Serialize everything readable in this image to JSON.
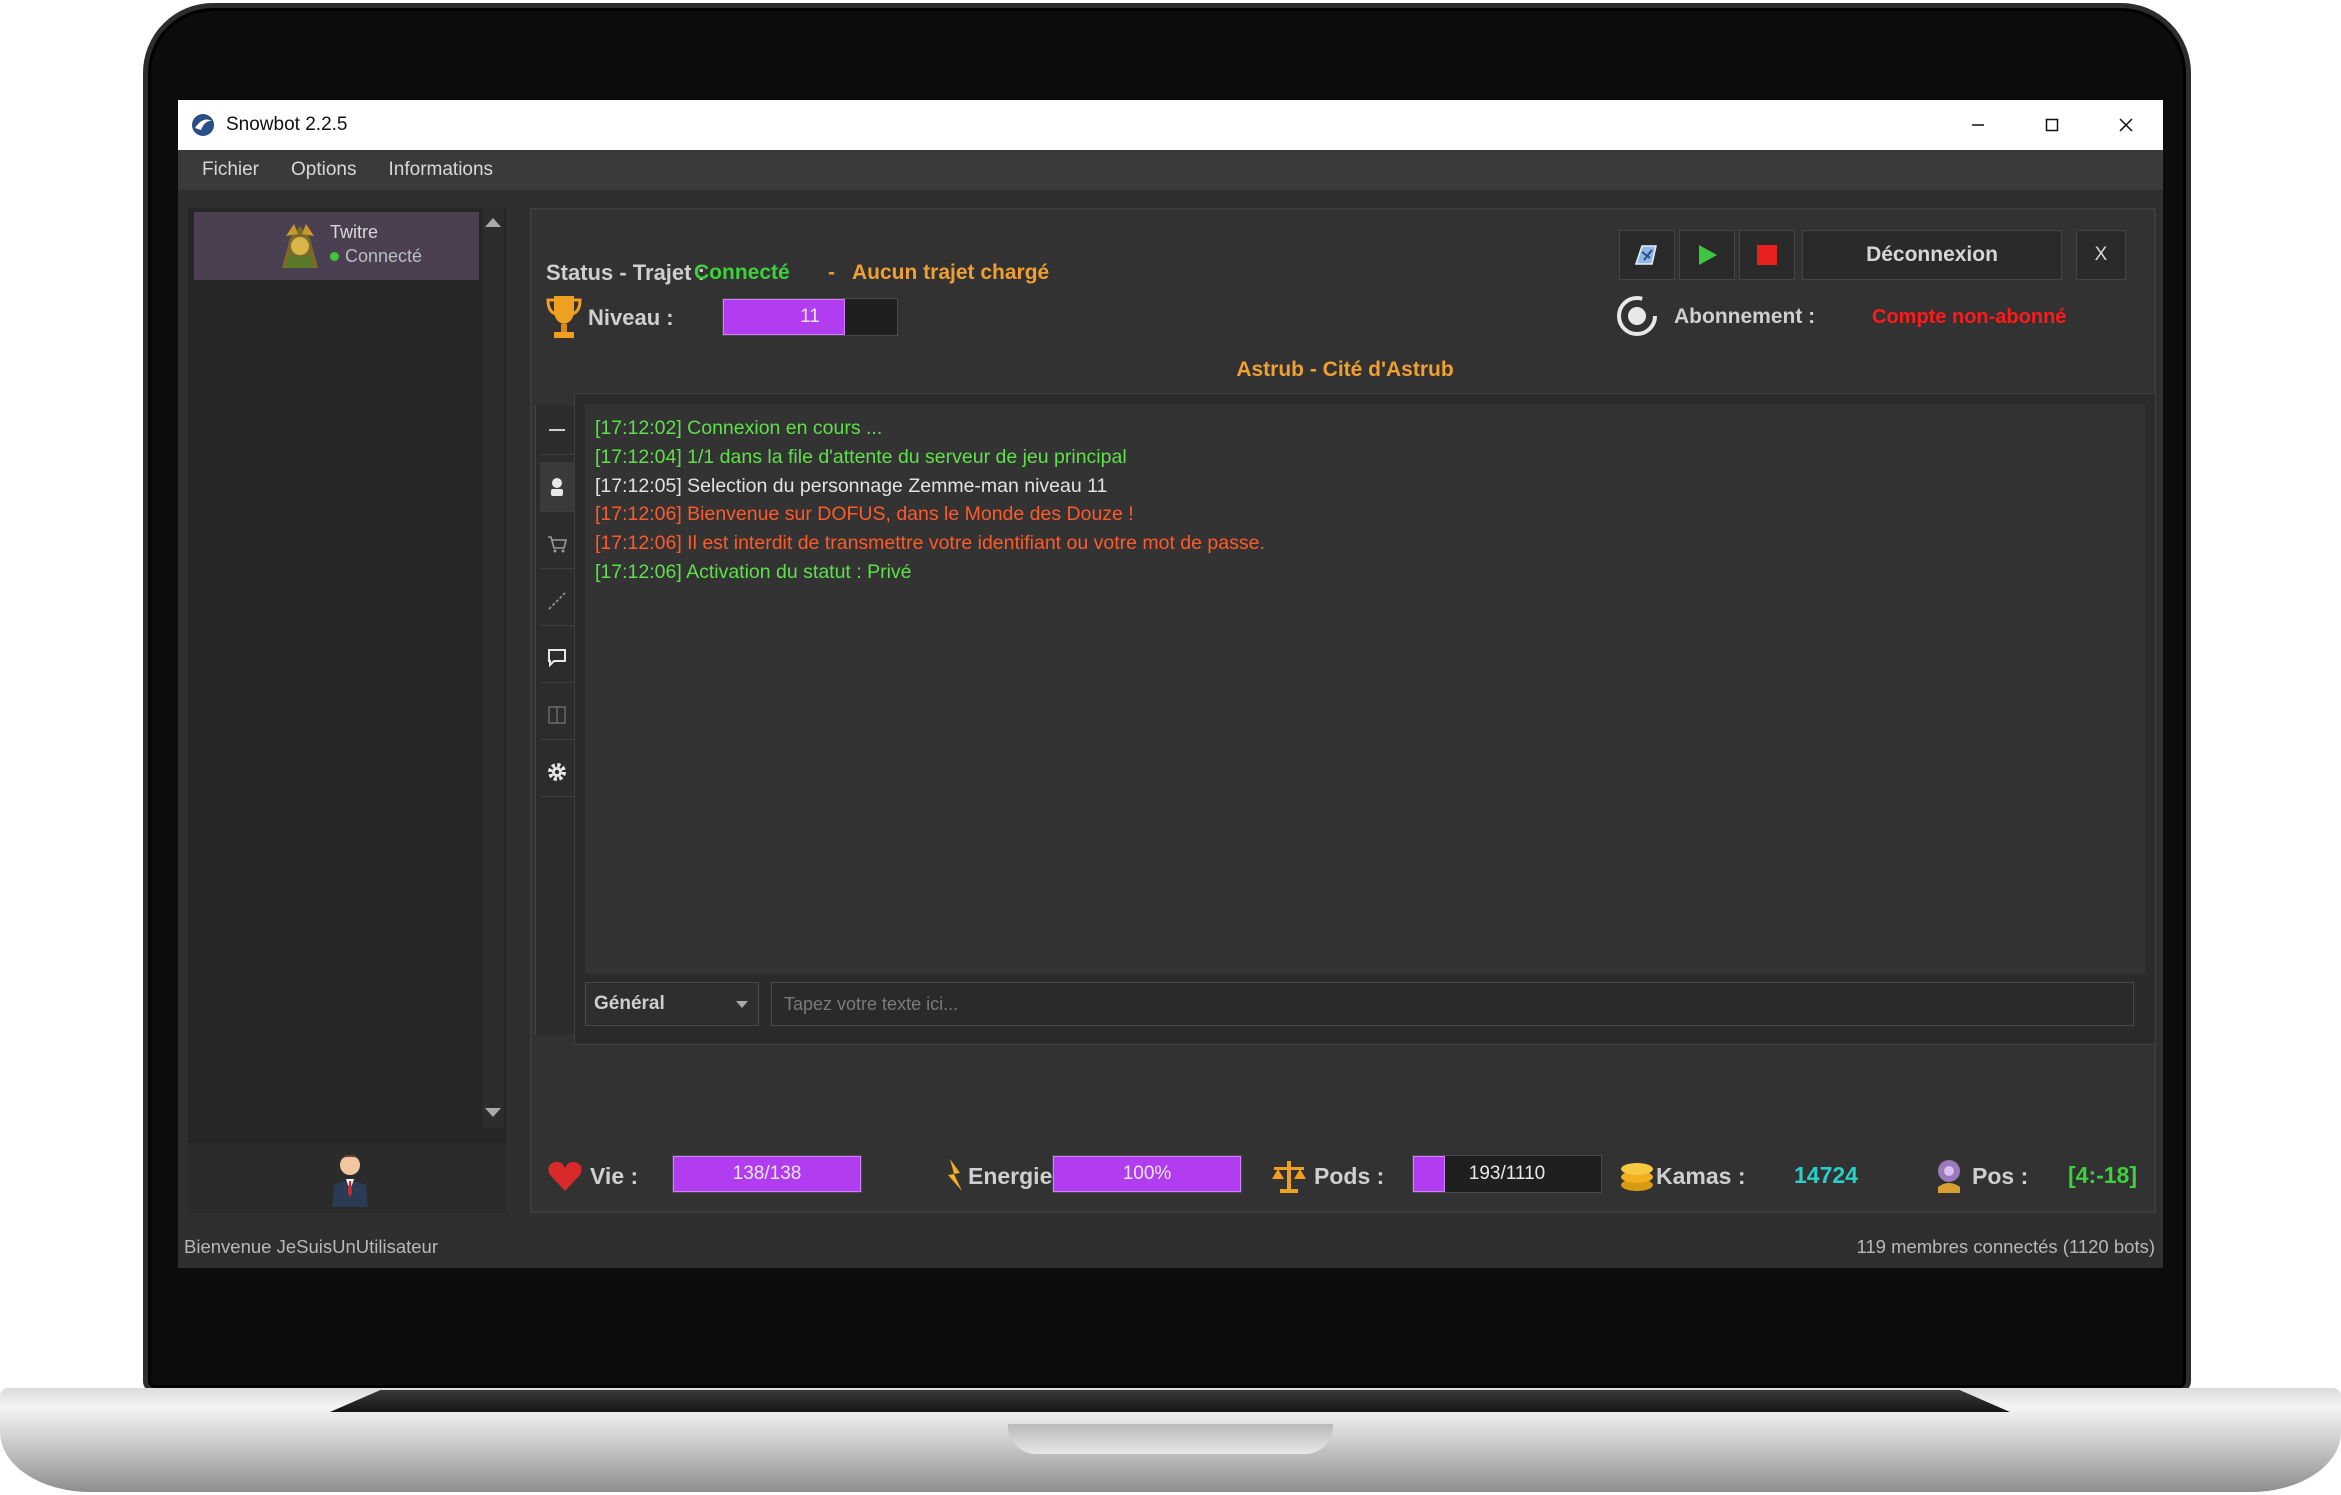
{
  "window": {
    "title": "Snowbot 2.2.5"
  },
  "menu": {
    "items": [
      "Fichier",
      "Options",
      "Informations"
    ]
  },
  "accounts": [
    {
      "name": "Twitre",
      "status": "Connecté"
    }
  ],
  "header": {
    "status_label": "Status - Trajet :",
    "status_value": "Connecté",
    "separator": "-",
    "trajet_value": "Aucun trajet chargé",
    "niveau_label": "Niveau :",
    "niveau_value": "11",
    "niveau_fill": 0.7,
    "disconnect_label": "Déconnexion",
    "close_label": "X",
    "abonnement_label": "Abonnement :",
    "abonnement_value": "Compte non-abonné",
    "location": "Astrub - Cité d'Astrub"
  },
  "console": {
    "lines": [
      {
        "text": "[17:12:02] Connexion en cours ...",
        "color": "#5fe04a"
      },
      {
        "text": "[17:12:04] 1/1 dans la file d'attente du serveur de jeu principal",
        "color": "#5fe04a"
      },
      {
        "text": "[17:12:05] Selection du personnage Zemme-man niveau 11",
        "color": "#e2e2e2"
      },
      {
        "text": "[17:12:06] Bienvenue sur DOFUS, dans le Monde des Douze !",
        "color": "#ff5a2a"
      },
      {
        "text": "[17:12:06] Il est interdit de transmettre votre identifiant ou votre mot de passe.",
        "color": "#ff5a2a"
      },
      {
        "text": "[17:12:06] Activation du statut : Privé",
        "color": "#5fe04a"
      }
    ],
    "channel": "Général",
    "input_placeholder": "Tapez votre texte ici..."
  },
  "stats": {
    "vie_label": "Vie :",
    "vie_value": "138/138",
    "vie_fill": 1.0,
    "energie_label": "Energie :",
    "energie_value": "100%",
    "energie_fill": 1.0,
    "pods_label": "Pods :",
    "pods_value": "193/1110",
    "pods_fill": 0.17,
    "kamas_label": "Kamas :",
    "kamas_value": "14724",
    "pos_label": "Pos :",
    "pos_value": "[4:-18]"
  },
  "statusbar": {
    "left": "Bienvenue JeSuisUnUtilisateur",
    "right": "119 membres connectés (1120 bots)"
  },
  "colors": {
    "accent_purple": "#b23cf0",
    "connected_green": "#3bd23b",
    "warning_orange": "#f0a030",
    "error_red": "#ff1a1a",
    "kamas_cyan": "#2ad0c8"
  }
}
